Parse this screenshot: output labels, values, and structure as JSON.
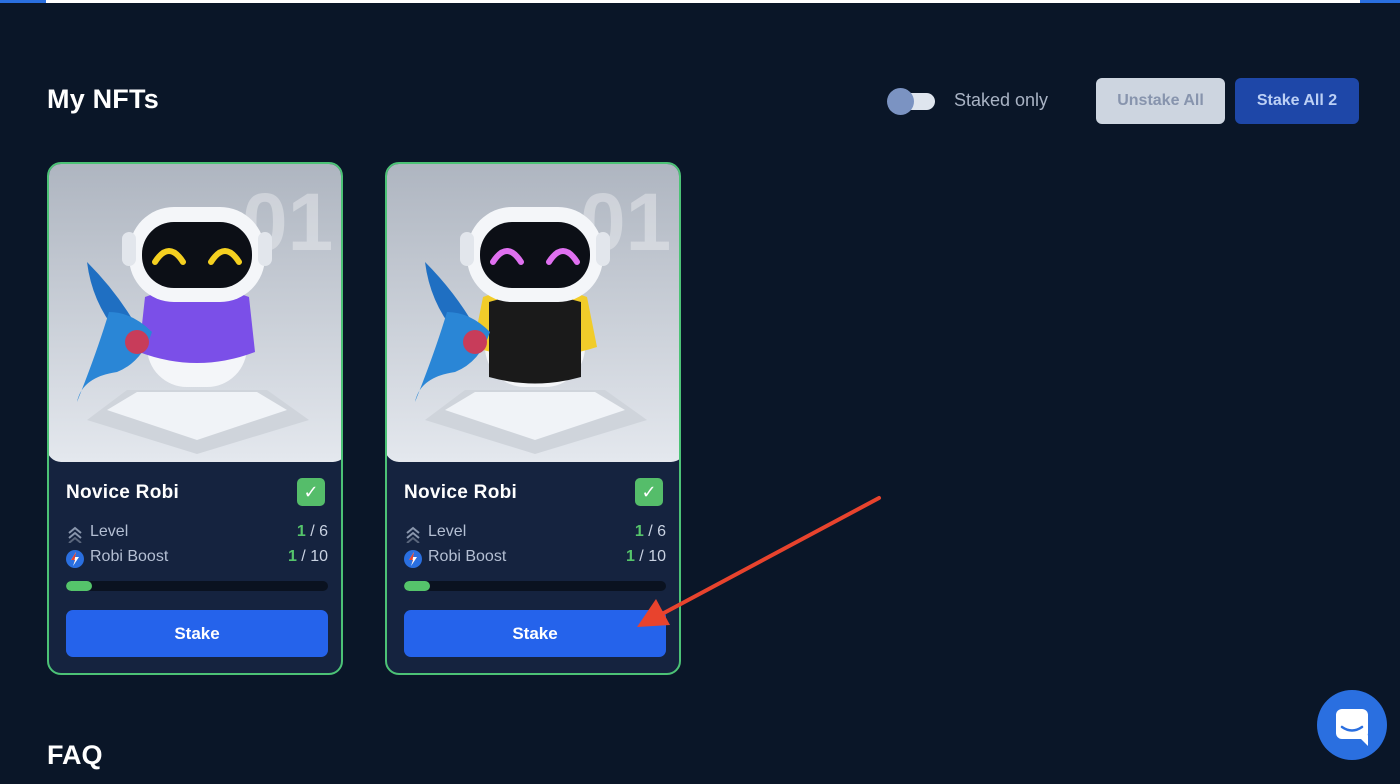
{
  "header": {
    "title": "My NFTs",
    "staked_only_label": "Staked only",
    "staked_only_on": false,
    "unstake_all_label": "Unstake All",
    "stake_all_label": "Stake All 2"
  },
  "cards": [
    {
      "name": "Novice Robi",
      "image_number": "01",
      "level_label": "Level",
      "level_current": "1",
      "level_max": " / 6",
      "boost_label": "Robi Boost",
      "boost_current": "1",
      "boost_max": " / 10",
      "progress": 0.1,
      "stake_label": "Stake",
      "hoodie_color": "#7b4fe8",
      "eye_color": "#f5d020"
    },
    {
      "name": "Novice Robi",
      "image_number": "01",
      "level_label": "Level",
      "level_current": "1",
      "level_max": " / 6",
      "boost_label": "Robi Boost",
      "boost_current": "1",
      "boost_max": " / 10",
      "progress": 0.1,
      "stake_label": "Stake",
      "hoodie_color": "#1a1a1a",
      "eye_color": "#e070f0"
    }
  ],
  "faq": {
    "title": "FAQ"
  },
  "colors": {
    "background": "#0a1628",
    "accent_green": "#55c46b",
    "primary_blue": "#2563eb",
    "annotation_arrow": "#e8432d"
  }
}
